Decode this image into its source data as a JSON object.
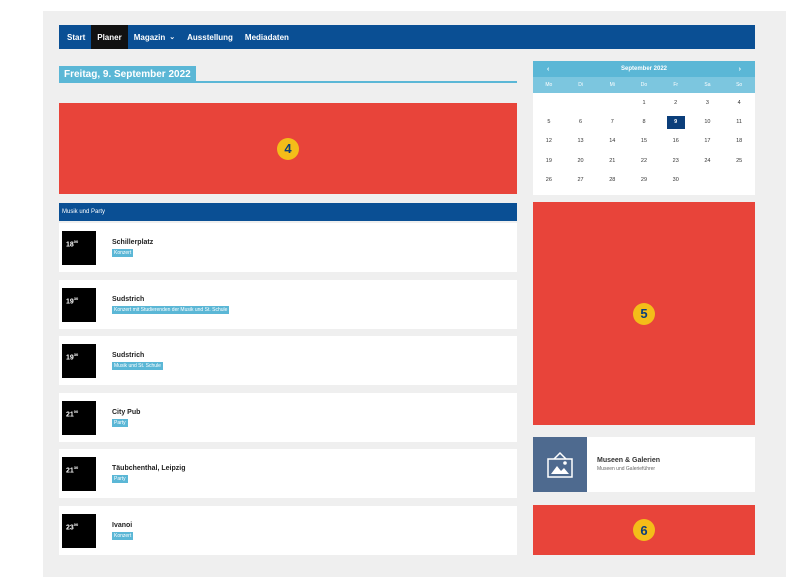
{
  "nav": {
    "items": [
      {
        "label": "Start"
      },
      {
        "label": "Planer"
      },
      {
        "label": "Magazin",
        "caret": "⌄"
      },
      {
        "label": "Ausstellung"
      },
      {
        "label": "Mediadaten"
      }
    ]
  },
  "page": {
    "date_heading": "Freitag, 9. September 2022",
    "section_title": "Musik und Party"
  },
  "ads": {
    "top": {
      "number": "4"
    },
    "side": {
      "number": "5"
    },
    "bottom": {
      "number": "6"
    }
  },
  "events": [
    {
      "hour": "18",
      "min": "00",
      "venue": "Schillerplatz",
      "tag": "Konzert"
    },
    {
      "hour": "19",
      "min": "30",
      "venue": "Sudstrich",
      "tag": "Konzert mit Studierenden der Musik und St. Schule"
    },
    {
      "hour": "19",
      "min": "30",
      "venue": "Sudstrich",
      "tag": "Musik und St. Schule"
    },
    {
      "hour": "21",
      "min": "00",
      "venue": "City Pub",
      "tag": "Party"
    },
    {
      "hour": "21",
      "min": "30",
      "venue": "Täubchenthal, Leipzig",
      "tag": "Party"
    },
    {
      "hour": "23",
      "min": "00",
      "venue": "Ivanoi",
      "tag": "Konzert"
    }
  ],
  "calendar": {
    "month": "September 2022",
    "prev": "‹",
    "next": "›",
    "weekdays": [
      "Mo",
      "Di",
      "Mi",
      "Do",
      "Fr",
      "Sa",
      "So"
    ],
    "days": [
      "",
      "",
      "",
      "1",
      "2",
      "3",
      "4",
      "5",
      "6",
      "7",
      "8",
      "9",
      "10",
      "11",
      "12",
      "13",
      "14",
      "15",
      "16",
      "17",
      "18",
      "19",
      "20",
      "21",
      "22",
      "23",
      "24",
      "25",
      "26",
      "27",
      "28",
      "29",
      "30",
      ""
    ],
    "today": "9"
  },
  "museum": {
    "title": "Museen & Galerien",
    "subtitle": "Museen und Galerieführer",
    "icon": "framed-picture-icon"
  },
  "colors": {
    "nav": "#0a4f94",
    "accent": "#5bb7d6",
    "ad": "#e8443a",
    "badge": "#f4bd19"
  }
}
